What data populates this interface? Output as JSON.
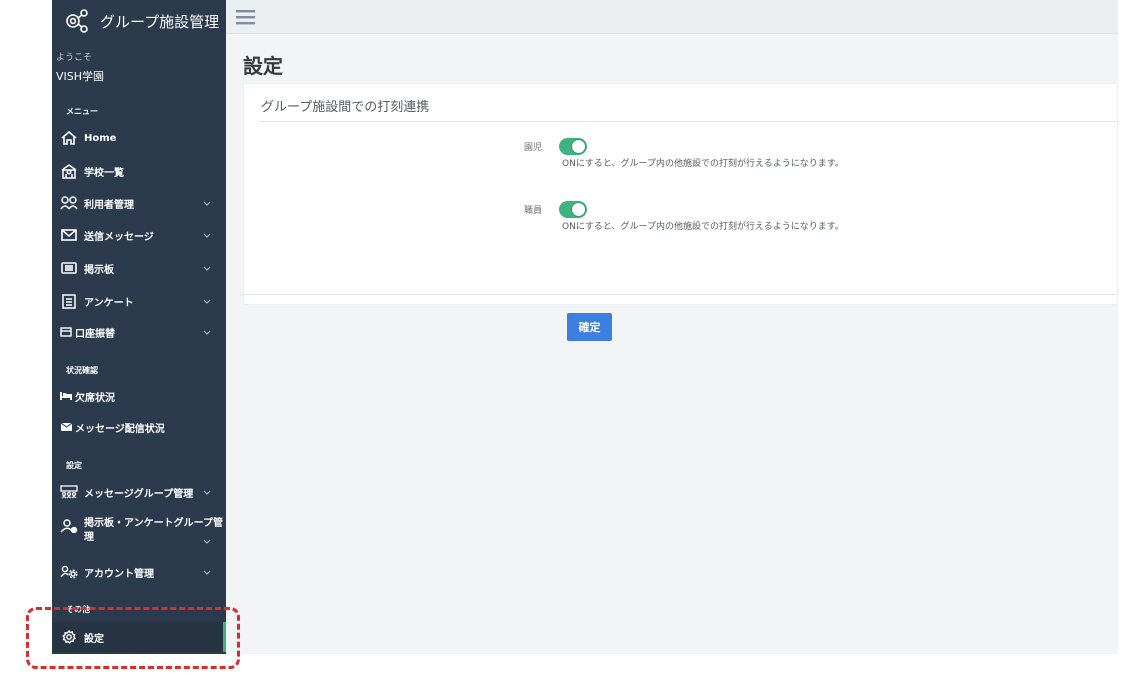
{
  "app": {
    "title": "グループ施設管理",
    "welcome": "ようこそ",
    "school": "VISH学園"
  },
  "sidebar": {
    "sections": {
      "menu": "メニュー",
      "status": "状況確認",
      "settings": "設定",
      "other": "その他"
    },
    "items": [
      {
        "label": "Home",
        "icon": "home-icon"
      },
      {
        "label": "学校一覧",
        "icon": "school-icon"
      },
      {
        "label": "利用者管理",
        "icon": "users-icon",
        "expandable": true
      },
      {
        "label": "送信メッセージ",
        "icon": "mail-icon",
        "expandable": true
      },
      {
        "label": "掲示板",
        "icon": "board-icon",
        "expandable": true
      },
      {
        "label": "アンケート",
        "icon": "survey-icon",
        "expandable": true
      },
      {
        "label": "口座振替",
        "icon": "card-icon",
        "expandable": true
      },
      {
        "label": "欠席状況",
        "icon": "bed-icon"
      },
      {
        "label": "メッセージ配信状況",
        "icon": "envelope-icon"
      },
      {
        "label": "メッセージグループ管理",
        "icon": "group-icon",
        "expandable": true
      },
      {
        "label": "掲示板・アンケートグループ管理",
        "icon": "user-group-icon",
        "expandable": true
      },
      {
        "label": "アカウント管理",
        "icon": "account-settings-icon",
        "expandable": true
      },
      {
        "label": "設定",
        "icon": "gear-icon",
        "active": true
      }
    ]
  },
  "main": {
    "page_title": "設定",
    "card_title": "グループ施設間での打刻連携",
    "rows": [
      {
        "label": "園児",
        "enabled": true,
        "description": "ONにすると、グループ内の他施設での打刻が行えるようになります。"
      },
      {
        "label": "職員",
        "enabled": true,
        "description": "ONにすると、グループ内の他施設での打刻が行えるようになります。"
      }
    ],
    "confirm_label": "確定"
  },
  "colors": {
    "sidebar_bg": "#2b3a4c",
    "toggle_on": "#3fb37f",
    "primary_button": "#3d7fe0",
    "annotation": "#d92d2d"
  }
}
